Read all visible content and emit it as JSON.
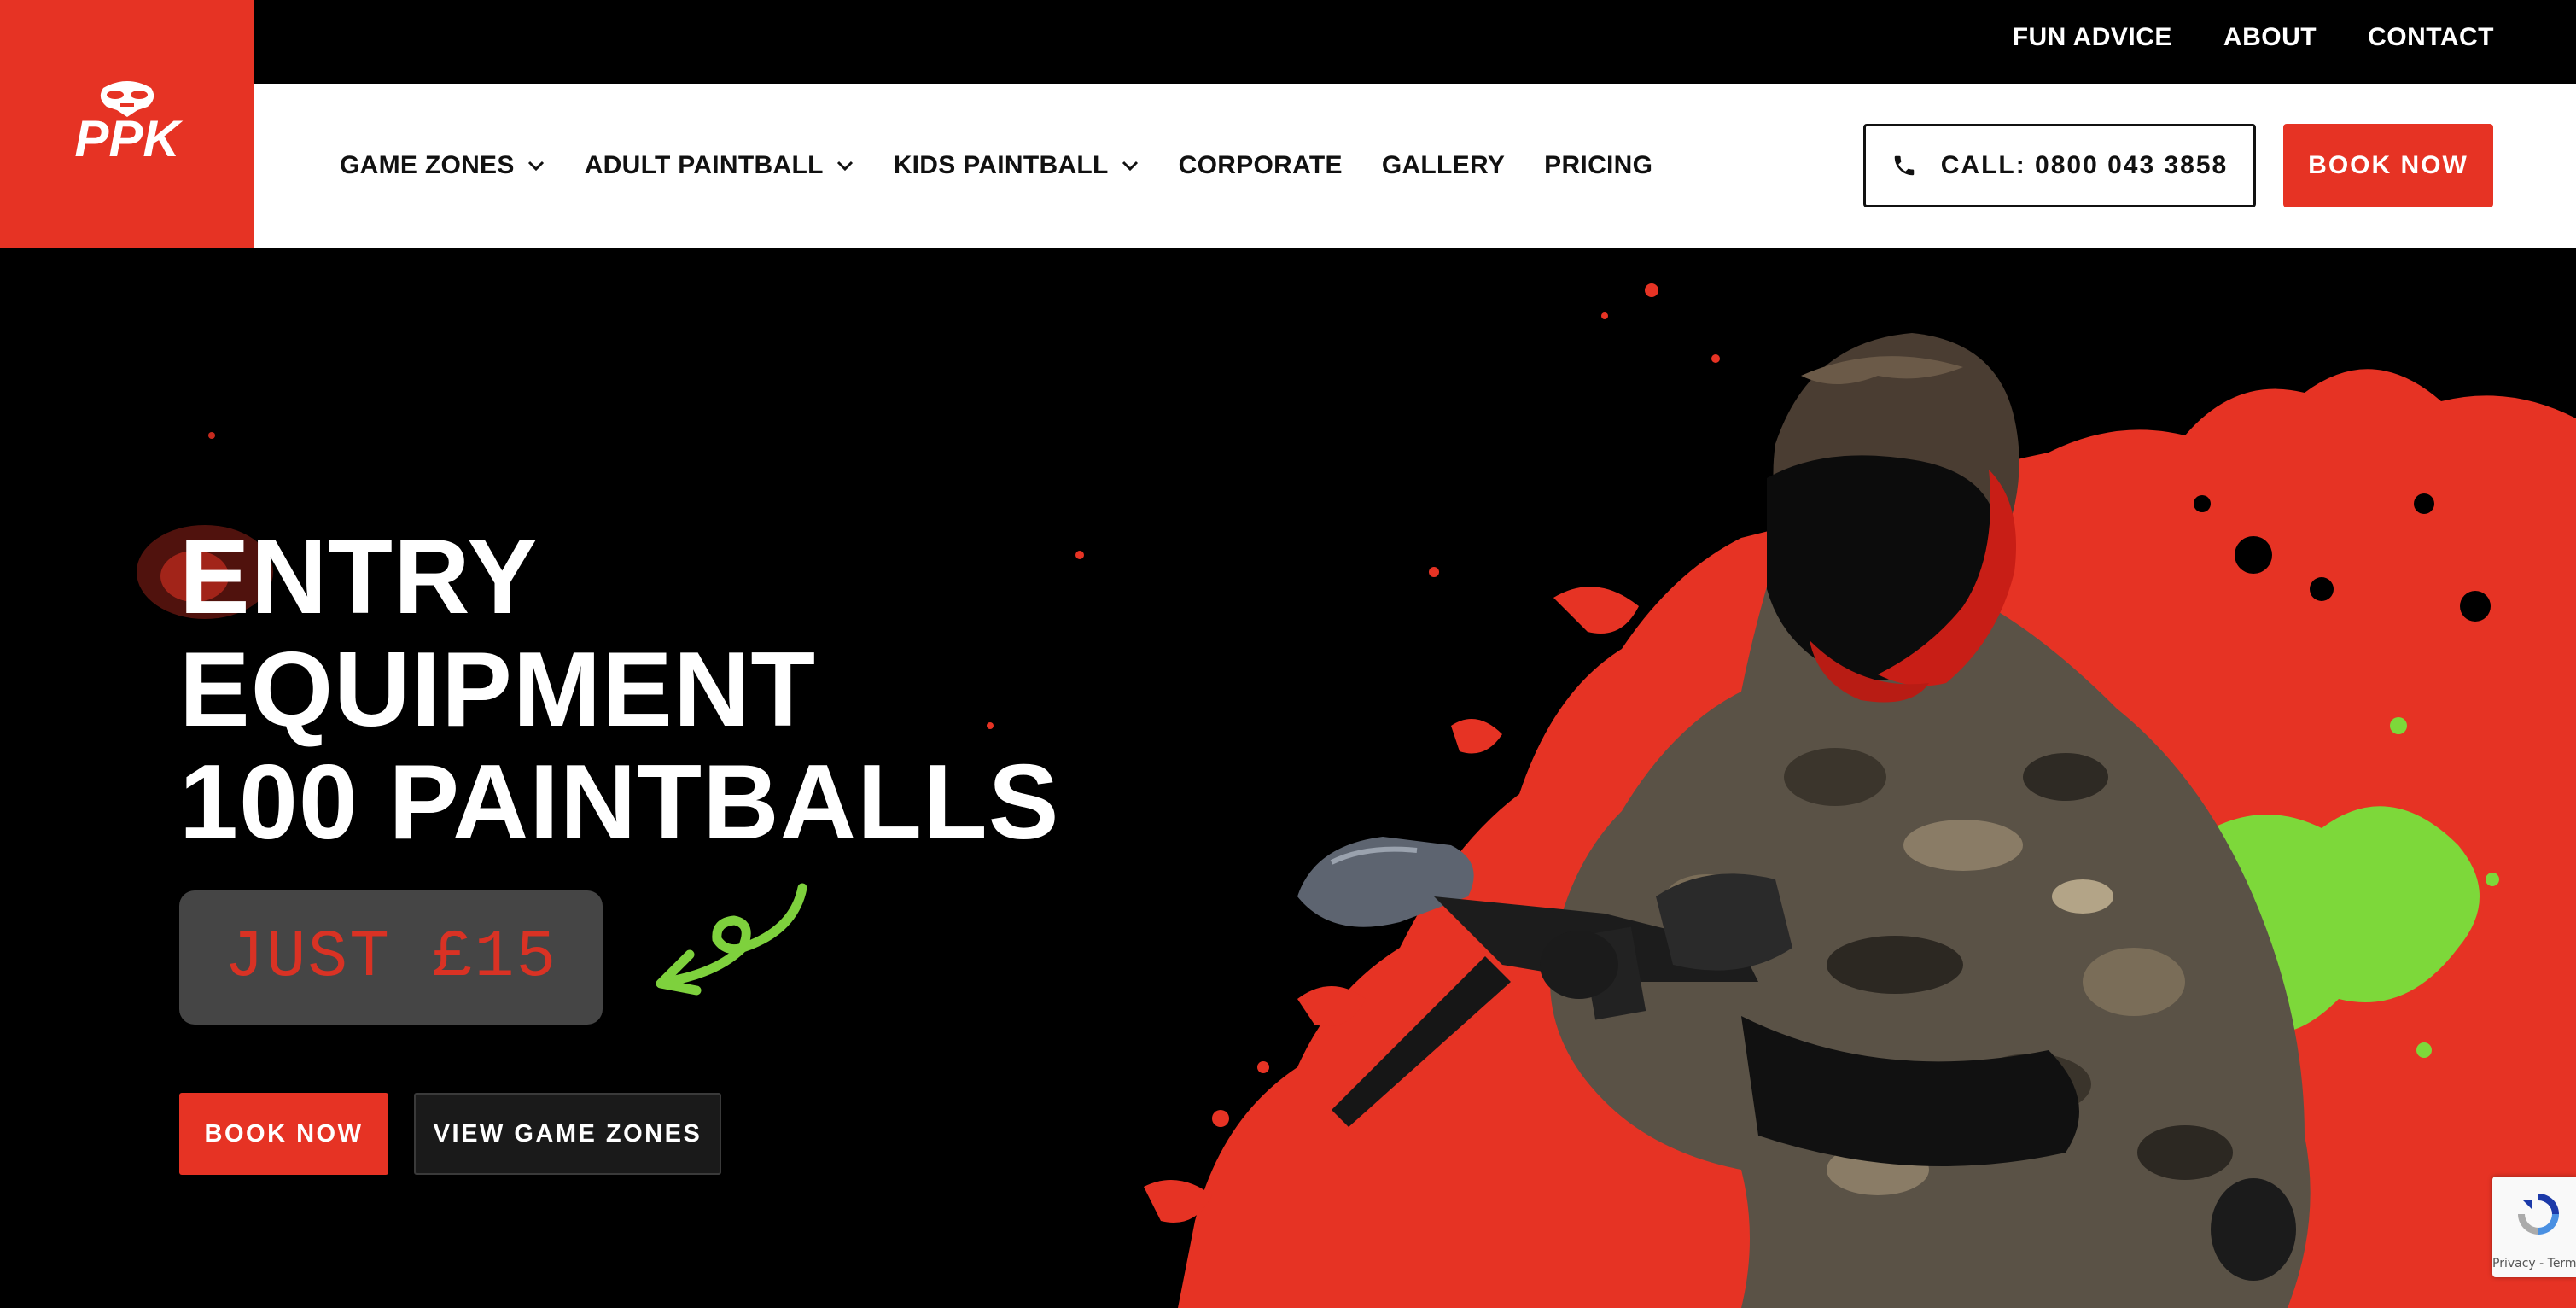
{
  "topbar": {
    "links": [
      "FUN ADVICE",
      "ABOUT",
      "CONTACT"
    ]
  },
  "logo": {
    "text": "PPK",
    "icon": "ppk-logo-icon"
  },
  "nav": {
    "items": [
      {
        "label": "GAME ZONES",
        "dropdown": true
      },
      {
        "label": "ADULT PAINTBALL",
        "dropdown": true
      },
      {
        "label": "KIDS PAINTBALL",
        "dropdown": true
      },
      {
        "label": "CORPORATE",
        "dropdown": false
      },
      {
        "label": "GALLERY",
        "dropdown": false
      },
      {
        "label": "PRICING",
        "dropdown": false
      }
    ],
    "call_label": "CALL: 0800 043 3858",
    "book_label": "BOOK NOW"
  },
  "hero": {
    "headline": [
      "ENTRY",
      "EQUIPMENT",
      "100 PAINTBALLS"
    ],
    "price": "JUST £15",
    "book_label": "BOOK NOW",
    "zones_label": "VIEW GAME ZONES"
  },
  "recaptcha": {
    "links": "Privacy - Terms"
  },
  "colors": {
    "brand_red": "#e63324",
    "price_box": "#454545",
    "arrow_green": "#7ed13d",
    "splat_green": "#7dd83a",
    "nav_background": "#ffffff",
    "hero_background": "#000000"
  }
}
